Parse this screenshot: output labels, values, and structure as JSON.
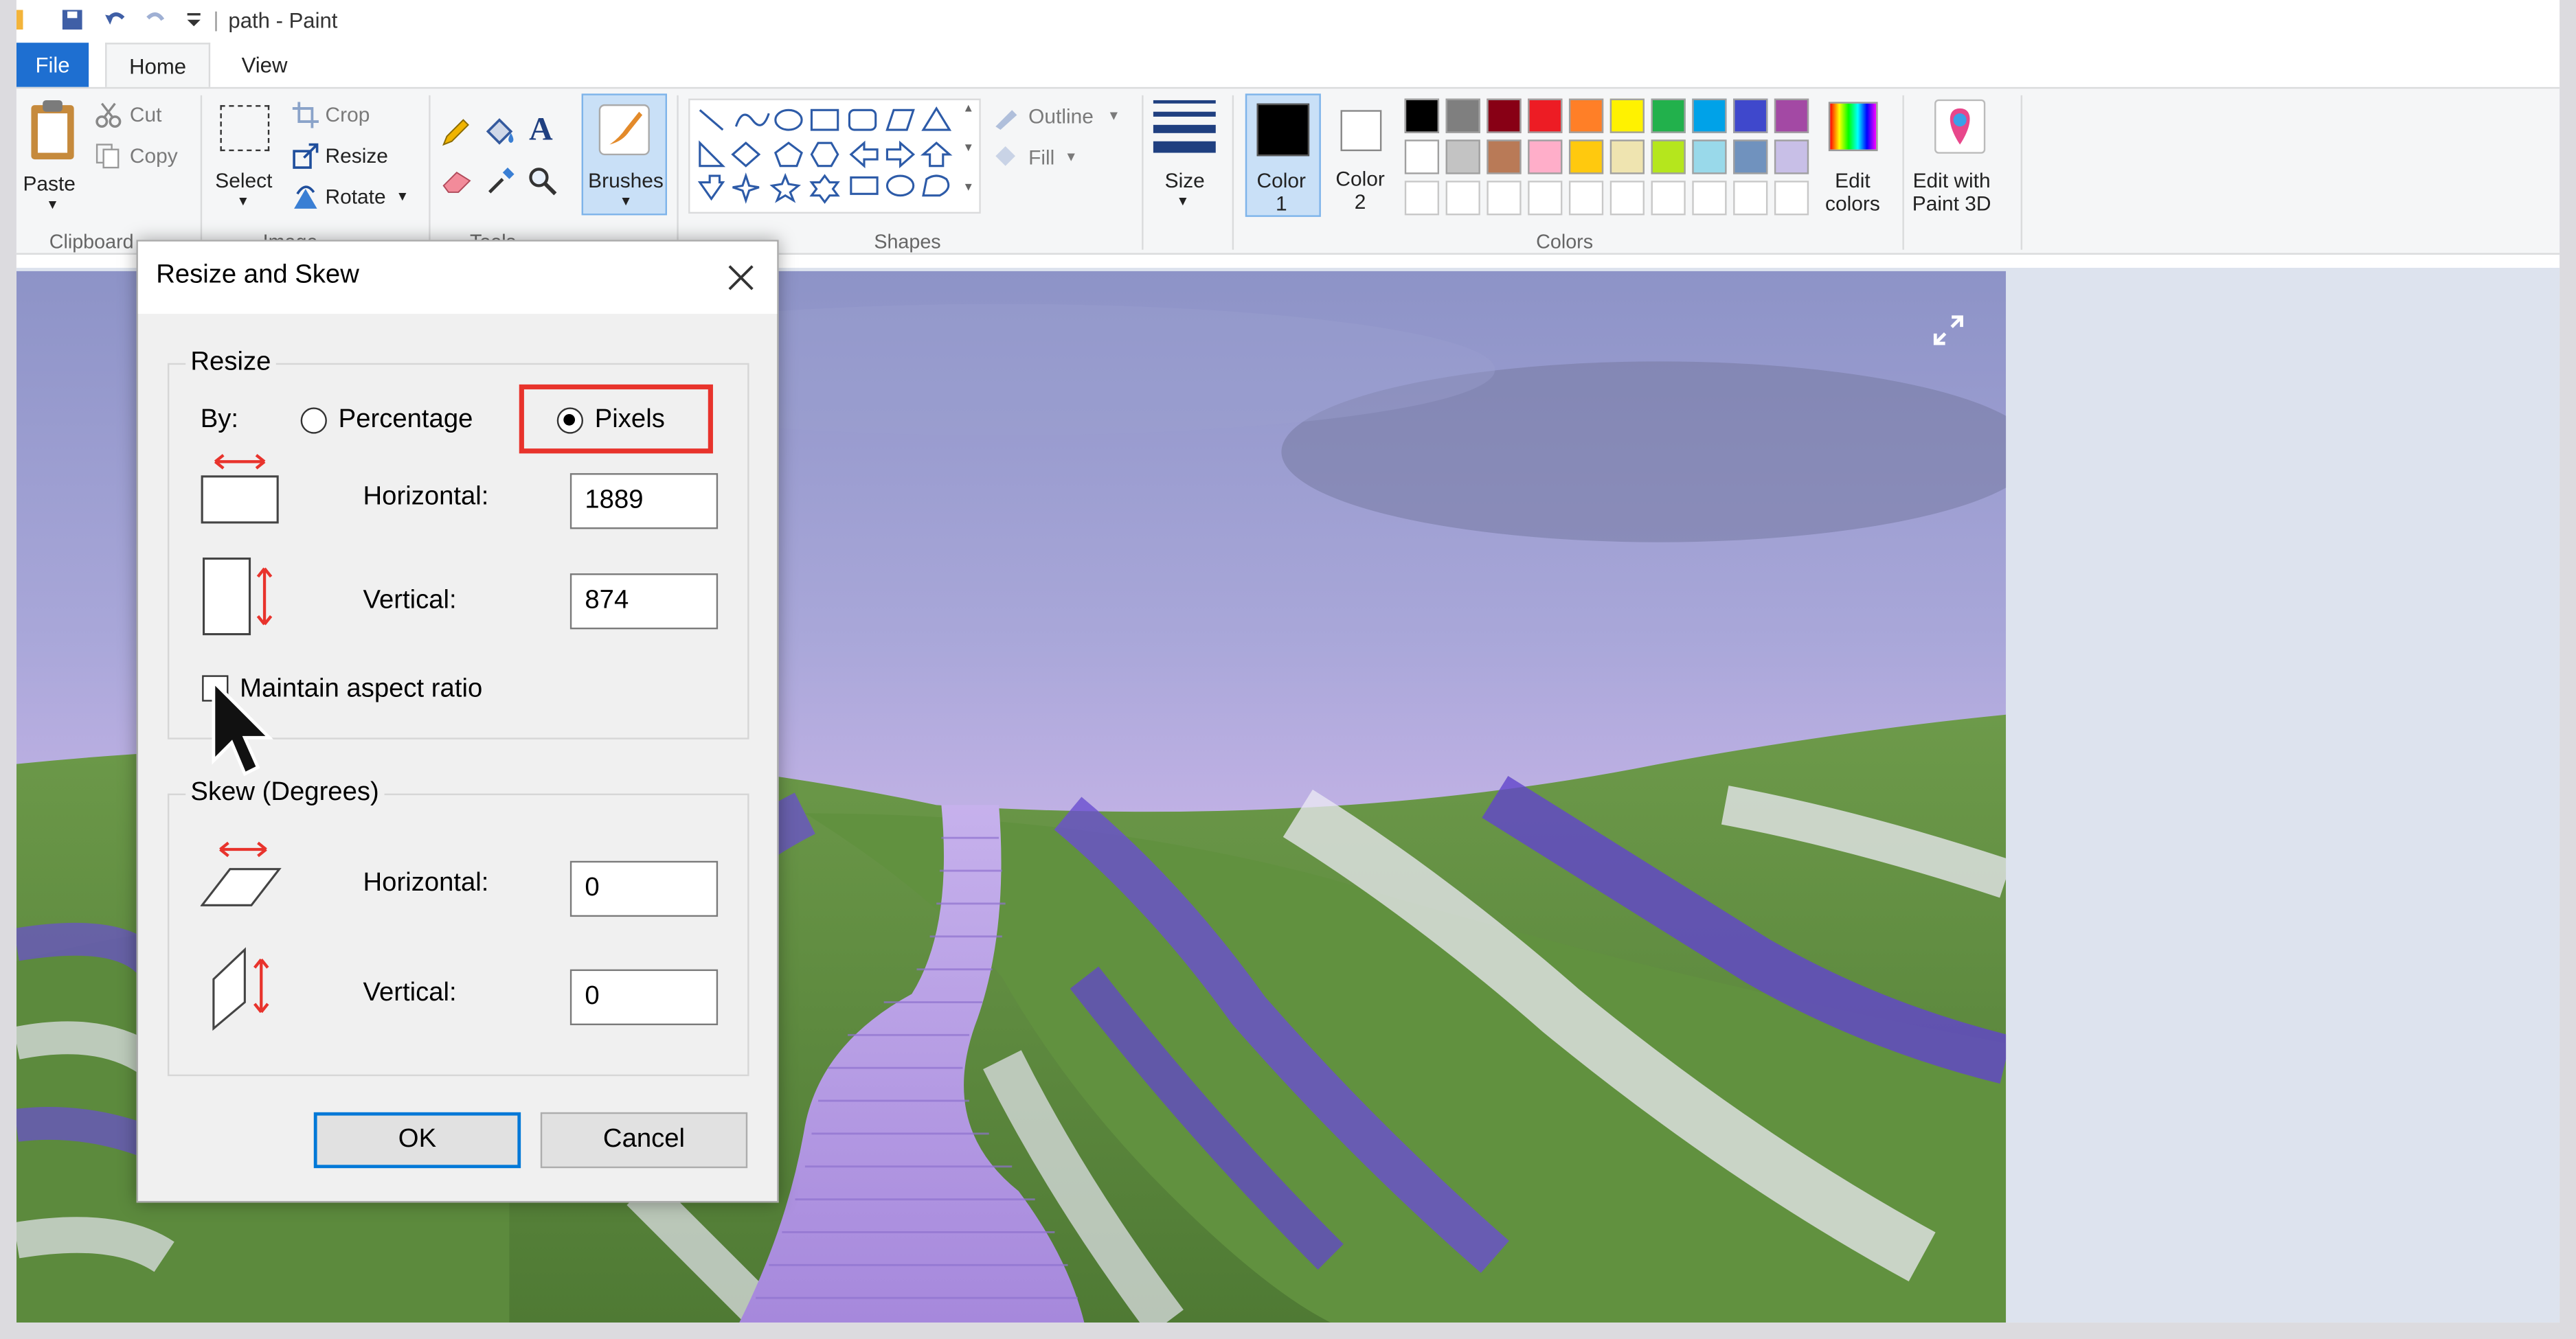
{
  "window": {
    "title": "path - Paint"
  },
  "tabs": {
    "file": "File",
    "home": "Home",
    "view": "View"
  },
  "ribbon": {
    "clipboard": {
      "paste": "Paste",
      "cut": "Cut",
      "copy": "Copy",
      "group": "Clipboard"
    },
    "image": {
      "select": "Select",
      "crop": "Crop",
      "resize": "Resize",
      "rotate": "Rotate",
      "group": "Image"
    },
    "tools": {
      "group": "Tools"
    },
    "brushes": "Brushes",
    "shapes": {
      "outline": "Outline",
      "fill": "Fill",
      "group": "Shapes"
    },
    "size": "Size",
    "color1": "Color\n1",
    "color2": "Color\n2",
    "colors_group": "Colors",
    "edit_colors": "Edit\ncolors",
    "edit_paint3d": "Edit with\nPaint 3D",
    "palette_row1": [
      "#000000",
      "#7f7f7f",
      "#880015",
      "#ed1c24",
      "#ff7f27",
      "#fff200",
      "#22b14c",
      "#00a2e8",
      "#3f48cc",
      "#a349a4"
    ],
    "palette_row2": [
      "#ffffff",
      "#c3c3c3",
      "#b97a57",
      "#ffaec9",
      "#ffc90e",
      "#efe4b0",
      "#b5e61d",
      "#99d9ea",
      "#7092be",
      "#c8bfe7"
    ]
  },
  "dialog": {
    "title": "Resize and Skew",
    "resize": {
      "legend": "Resize",
      "by_label": "By:",
      "percentage_label": "Percentage",
      "pixels_label": "Pixels",
      "horizontal_label": "Horizontal:",
      "horizontal_value": "1889",
      "vertical_label": "Vertical:",
      "vertical_value": "874",
      "maintain_label": "Maintain aspect ratio"
    },
    "skew": {
      "legend": "Skew (Degrees)",
      "horizontal_label": "Horizontal:",
      "horizontal_value": "0",
      "vertical_label": "Vertical:",
      "vertical_value": "0"
    },
    "ok": "OK",
    "cancel": "Cancel"
  }
}
